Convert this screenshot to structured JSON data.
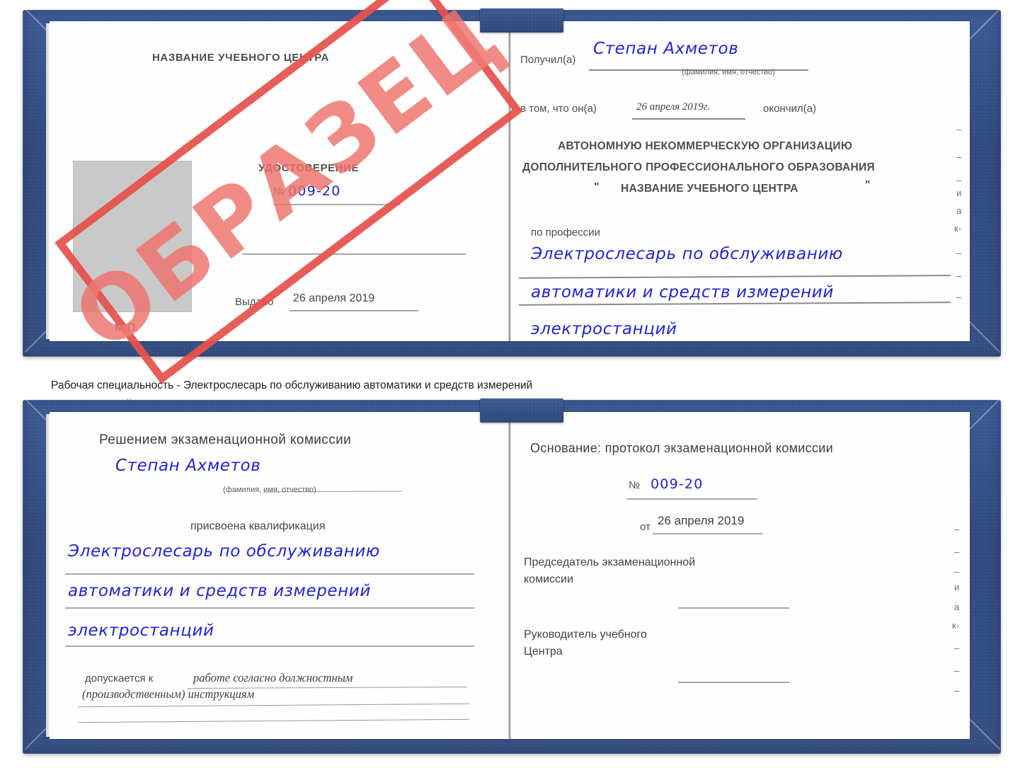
{
  "document": {
    "type": "certificate-scan",
    "stamp_text": "ОБРАЗЕЦ",
    "colors": {
      "cover_blue": "#24437f",
      "stamp_red": "#e8514d",
      "handwriting_blue": "#2222d8",
      "photo_placeholder_gray": "#c9c9c9"
    }
  },
  "caption": {
    "line1": "Рабочая специальность - Электрослесарь по обслуживанию автоматики и средств измерений",
    "line2": "электростанций"
  },
  "cert_top": {
    "left_page": {
      "center_name": "НАЗВАНИЕ УЧЕБНОГО ЦЕНТРА",
      "title": "УДОСТОВЕРЕНИЕ",
      "number_label": "№",
      "number_value": "009-20",
      "issued_label": "Выдано",
      "issued_value": "26 апреля 2019",
      "seal_label": "М.П."
    },
    "right_page": {
      "received_label": "Получил(а)",
      "received_value": "Степан Ахметов",
      "fio_hint": "(фамилия, имя, отчество)",
      "in_that_label": "в том, что он(а)",
      "completion_date": "26 апреля 2019г.",
      "finished_label": "окончил(а)",
      "org_line1": "АВТОНОМНУЮ НЕКОММЕРЧЕСКУЮ ОРГАНИЗАЦИЮ",
      "org_line2": "ДОПОЛНИТЕЛЬНОГО ПРОФЕССИОНАЛЬНОГО ОБРАЗОВАНИЯ",
      "org_quote_open": "\"",
      "org_line3": "НАЗВАНИЕ УЧЕБНОГО ЦЕНТРА",
      "org_quote_close": "\"",
      "profession_label": "по профессии",
      "profession_line1": "Электрослесарь по обслуживанию",
      "profession_line2": "автоматики и средств измерений",
      "profession_line3": "электростанций",
      "edge_fragments": [
        "–",
        "–",
        "–",
        "–",
        "и",
        "а",
        "к-",
        "–",
        "–",
        "–"
      ]
    }
  },
  "cert_bottom": {
    "left_page": {
      "decision_label": "Решением экзаменационной комиссии",
      "name_value": "Степан Ахметов",
      "fio_hint": "(фамилия, имя, отчество)",
      "qualification_label": "присвоена квалификация",
      "qualification_line1": "Электрослесарь по обслуживанию",
      "qualification_line2": "автоматики и средств измерений",
      "qualification_line3": "электростанций",
      "allowed_label": "допускается к",
      "allowed_value_line1": "работе согласно должностным",
      "allowed_value_line2": "(производственным) инструкциям"
    },
    "right_page": {
      "basis_label": "Основание: протокол экзаменационной комиссии",
      "number_label": "№",
      "number_value": "009-20",
      "date_label": "от",
      "date_value": "26 апреля 2019",
      "chairman_line1": "Председатель экзаменационной",
      "chairman_line2": "комиссии",
      "head_line1": "Руководитель учебного",
      "head_line2": "Центра",
      "edge_fragments": [
        "–",
        "–",
        "–",
        "и",
        "а",
        "к-",
        "–",
        "–",
        "–"
      ]
    }
  }
}
